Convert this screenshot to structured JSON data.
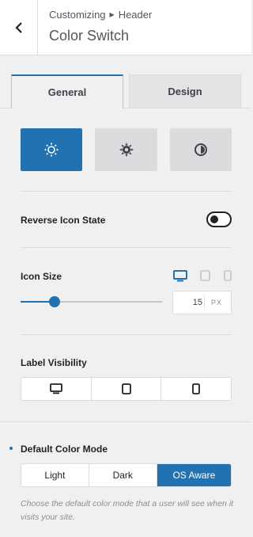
{
  "header": {
    "breadcrumb_parent": "Customizing",
    "breadcrumb_child": "Header",
    "title": "Color Switch",
    "back_icon": "chevron-left-icon"
  },
  "tabs": [
    {
      "label": "General",
      "active": true
    },
    {
      "label": "Design",
      "active": false
    }
  ],
  "icon_options": [
    {
      "icon": "sun-outline-icon",
      "selected": true
    },
    {
      "icon": "sun-filled-icon",
      "selected": false
    },
    {
      "icon": "contrast-icon",
      "selected": false
    }
  ],
  "reverse_icon_state": {
    "label": "Reverse Icon State",
    "enabled": false
  },
  "icon_size": {
    "label": "Icon Size",
    "devices": [
      "desktop-icon",
      "tablet-icon",
      "mobile-icon"
    ],
    "active_device": "desktop",
    "value": "15",
    "unit": "PX",
    "slider_fraction": 0.24
  },
  "label_visibility": {
    "label": "Label Visibility",
    "options": [
      "desktop-icon",
      "tablet-icon",
      "mobile-icon"
    ]
  },
  "default_color_mode": {
    "label": "Default Color Mode",
    "options": [
      "Light",
      "Dark",
      "OS Aware"
    ],
    "selected": "OS Aware",
    "description": "Choose the default color mode that a user will see when it visits your site."
  },
  "colors": {
    "accent": "#2271b1",
    "panel": "#f0f0f1",
    "border": "#dcdcde"
  }
}
